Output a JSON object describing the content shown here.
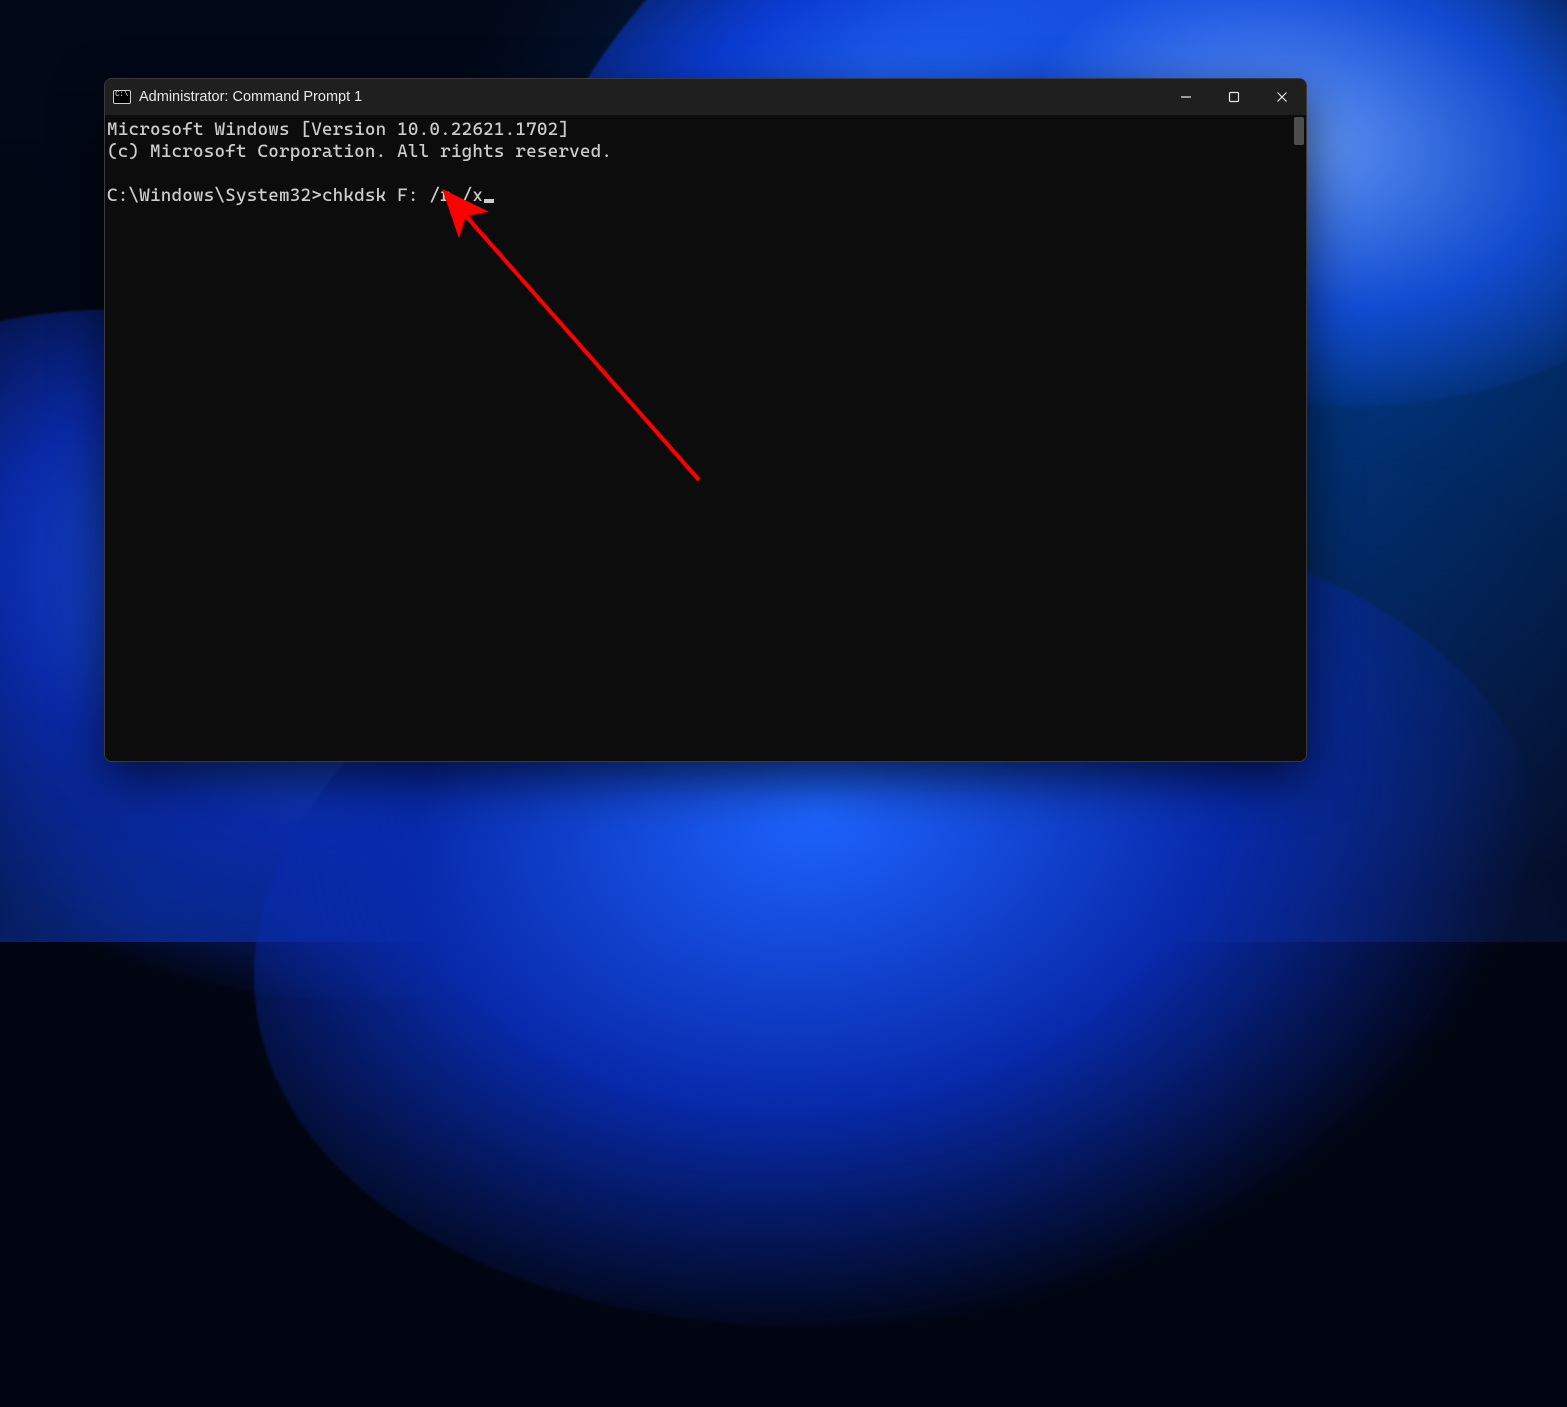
{
  "window": {
    "title": "Administrator: Command Prompt 1"
  },
  "terminal": {
    "line1": "Microsoft Windows [Version 10.0.22621.1702]",
    "line2": "(c) Microsoft Corporation. All rights reserved.",
    "blank": "",
    "prompt": "C:\\Windows\\System32>",
    "command": "chkdsk F: /r /x"
  },
  "icons": {
    "minimize": "minimize-icon",
    "maximize": "maximize-icon",
    "close": "close-icon",
    "app": "cmd-icon"
  }
}
